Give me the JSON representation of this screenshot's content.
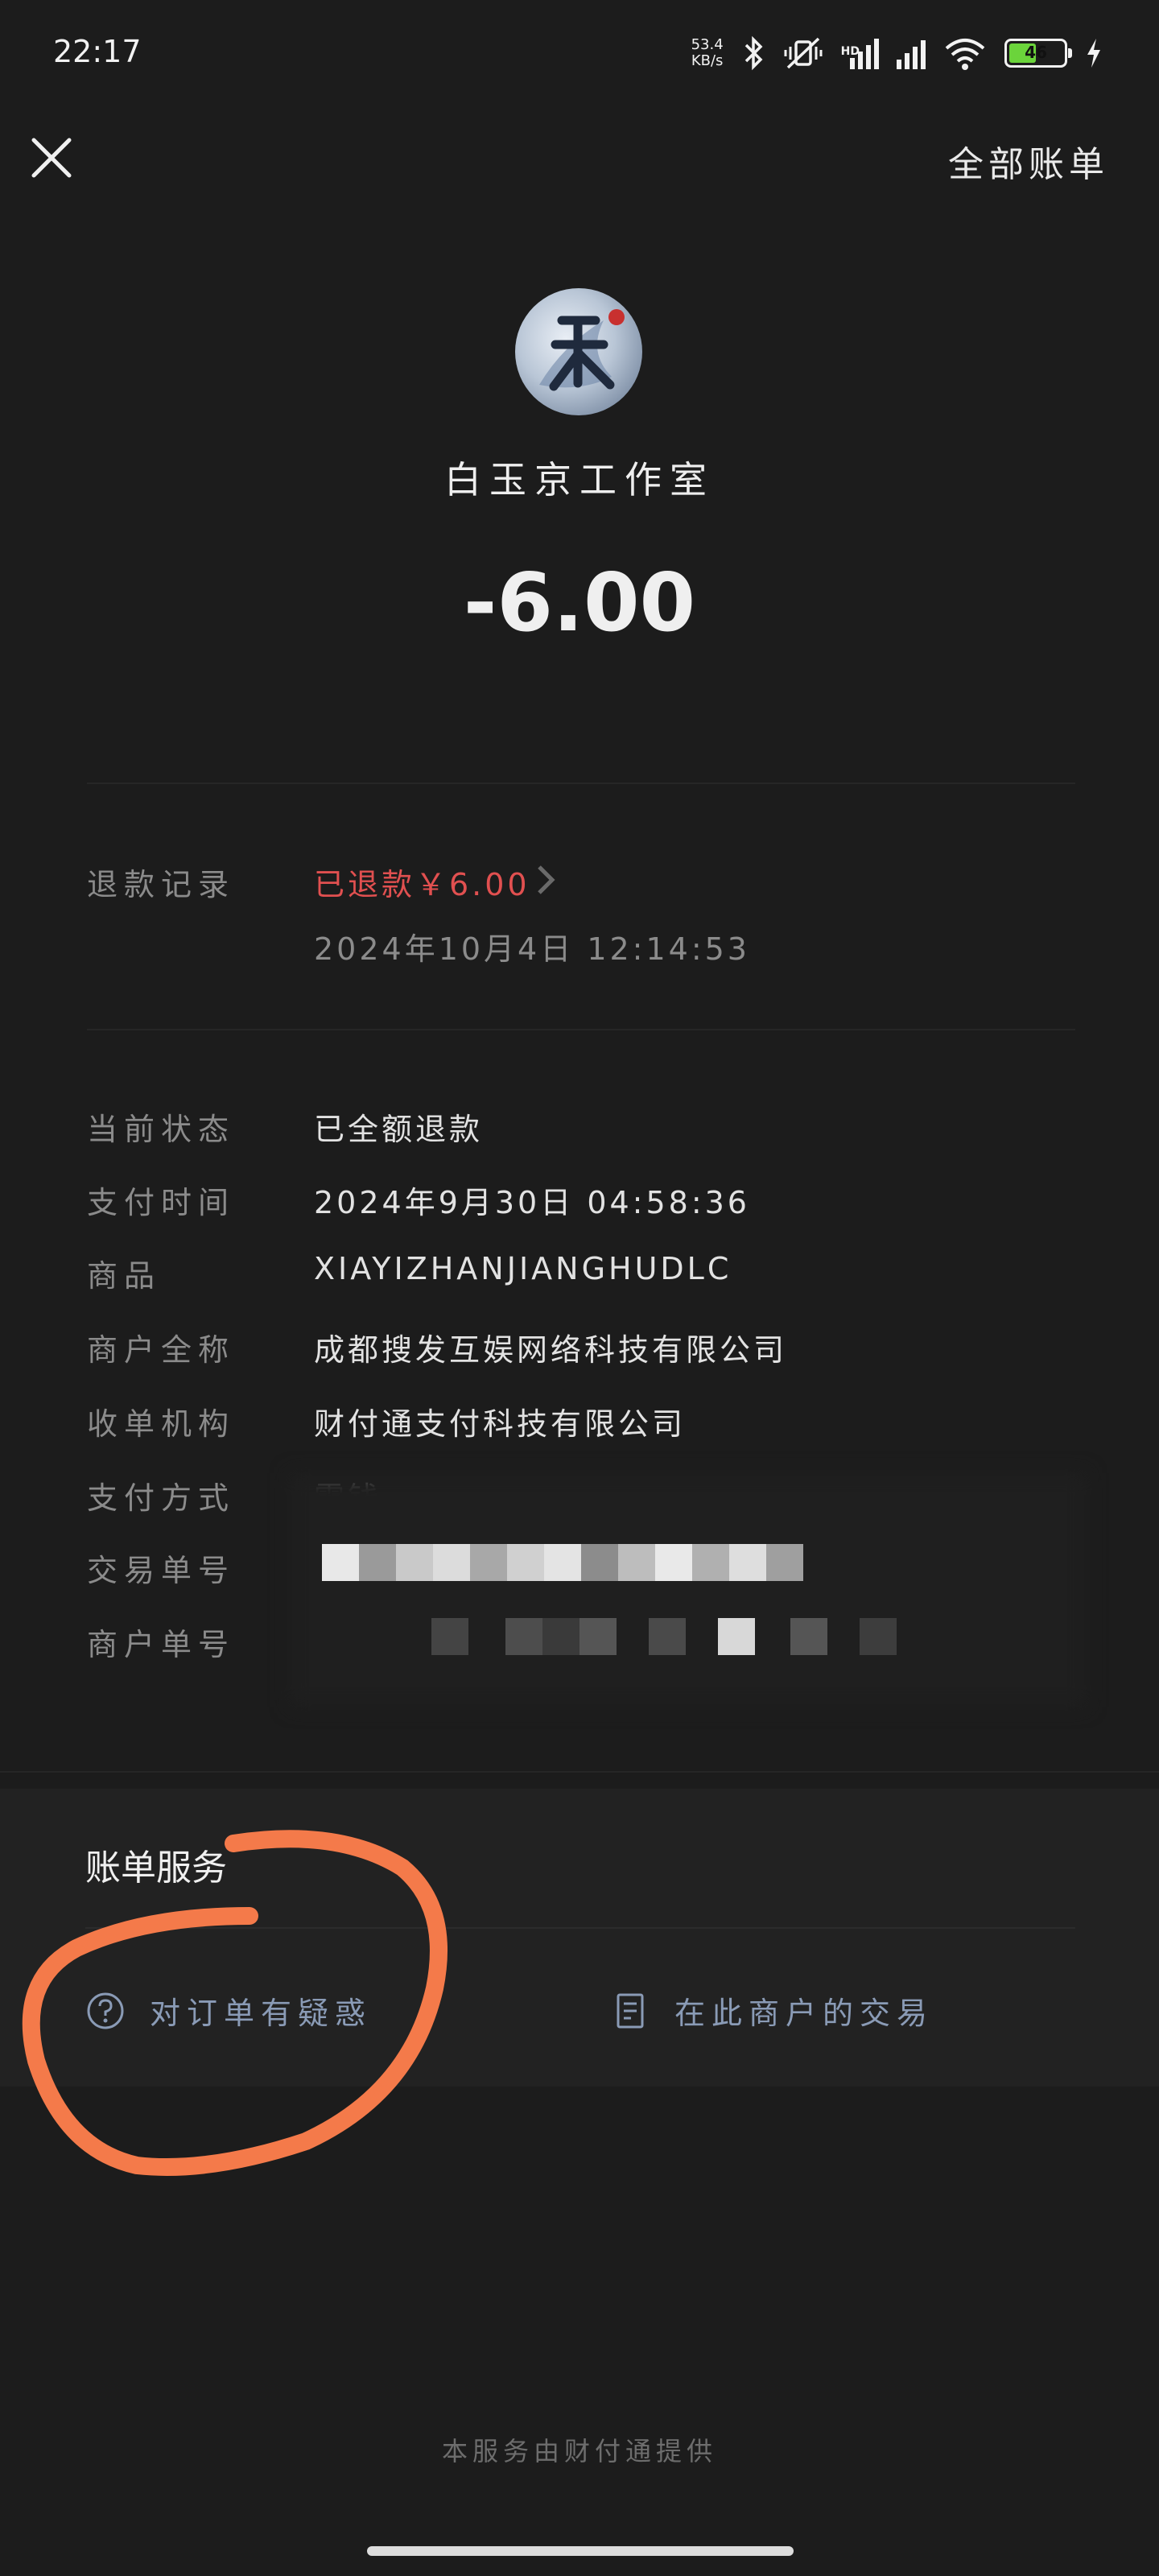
{
  "status_bar": {
    "time": "22:17",
    "net_speed_value": "53.4",
    "net_speed_unit": "KB/s",
    "hd_label": "HD",
    "battery_level": "46",
    "icons": [
      "bluetooth-icon",
      "mute-vibrate-icon",
      "signal-hd-icon",
      "signal-icon",
      "wifi-icon",
      "battery-icon",
      "charging-icon"
    ]
  },
  "header": {
    "close_icon": "close-icon",
    "all_bills_label": "全部账单"
  },
  "merchant": {
    "name": "白玉京工作室",
    "amount": "-6.00"
  },
  "refund": {
    "label": "退款记录",
    "status": "已退款￥6.00",
    "date": "2024年10月4日  12:14:53"
  },
  "details": [
    {
      "label": "当前状态",
      "value": "已全额退款"
    },
    {
      "label": "支付时间",
      "value": "2024年9月30日  04:58:36"
    },
    {
      "label": "商品",
      "value": "XIAYIZHANJIANGHUDLC"
    },
    {
      "label": "商户全称",
      "value": "成都搜发互娱网络科技有限公司"
    },
    {
      "label": "收单机构",
      "value": "财付通支付科技有限公司"
    },
    {
      "label": "支付方式",
      "value": "零钱"
    },
    {
      "label": "交易单号",
      "value": ""
    },
    {
      "label": "商户单号",
      "value": ""
    }
  ],
  "services": {
    "title": "账单服务",
    "question_label": "对订单有疑惑",
    "merchant_tx_label": "在此商户的交易"
  },
  "footer": "本服务由财付通提供",
  "colors": {
    "background": "#1c1c1c",
    "refund_red": "#e15050",
    "service_blue": "#8a9bb6",
    "annotation_orange": "#f47a4a"
  }
}
